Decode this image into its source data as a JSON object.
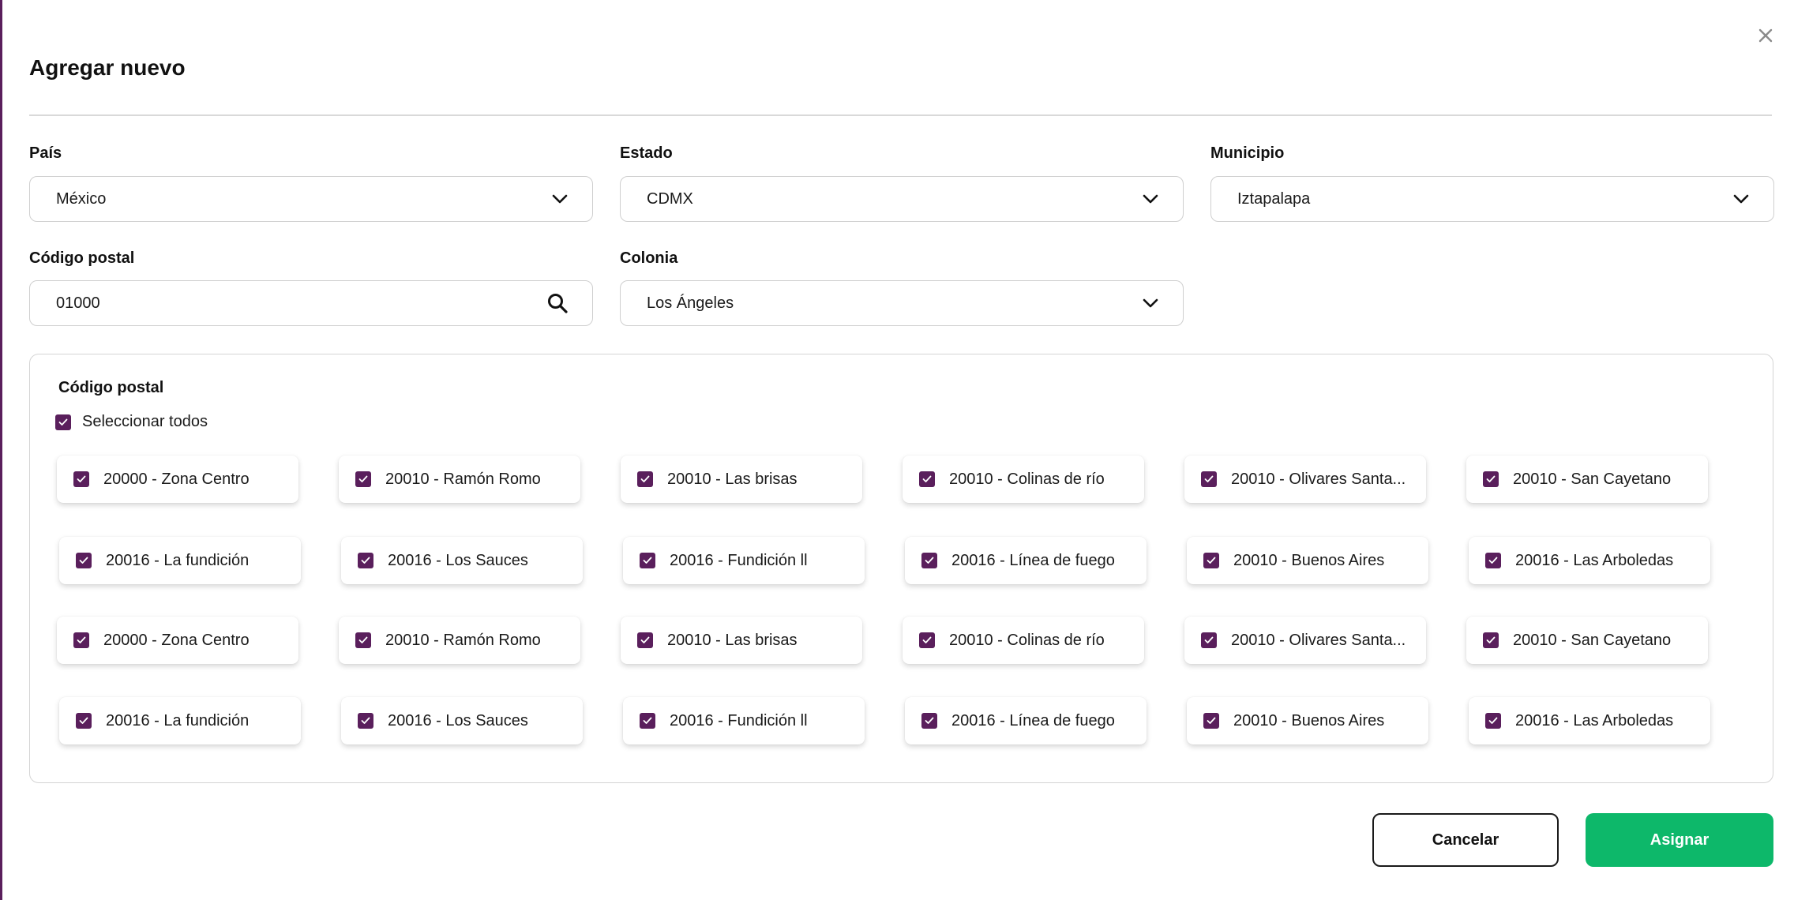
{
  "dialog": {
    "title": "Agregar nuevo",
    "close_icon": "close-icon"
  },
  "fields": {
    "pais": {
      "label": "País",
      "value": "México"
    },
    "estado": {
      "label": "Estado",
      "value": "CDMX"
    },
    "municipio": {
      "label": "Municipio",
      "value": "Iztapalapa"
    },
    "codigo_postal": {
      "label": "Código postal",
      "value": "01000"
    },
    "colonia": {
      "label": "Colonia",
      "value": "Los Ángeles"
    }
  },
  "postal_panel": {
    "title": "Código postal",
    "select_all_label": "Seleccionar todos",
    "select_all_checked": true,
    "rows": [
      [
        "20000 - Zona Centro",
        "20010 - Ramón Romo",
        "20010 - Las brisas",
        "20010 - Colinas de río",
        "20010 - Olivares Santa...",
        "20010 - San Cayetano"
      ],
      [
        "20016 - La fundición",
        "20016 - Los Sauces",
        "20016 - Fundición ll",
        "20016 - Línea de fuego",
        "20010 - Buenos Aires",
        "20016 - Las Arboledas"
      ],
      [
        "20000 - Zona Centro",
        "20010 - Ramón Romo",
        "20010 - Las brisas",
        "20010 - Colinas de río",
        "20010 - Olivares Santa...",
        "20010 - San Cayetano"
      ],
      [
        "20016 - La fundición",
        "20016 - Los Sauces",
        "20016 - Fundición ll",
        "20016 - Línea de fuego",
        "20010 - Buenos Aires",
        "20016 - Las Arboledas"
      ]
    ]
  },
  "actions": {
    "cancel_label": "Cancelar",
    "assign_label": "Asignar"
  },
  "colors": {
    "accent": "#5a1f5c",
    "primary_button": "#0db86a"
  }
}
